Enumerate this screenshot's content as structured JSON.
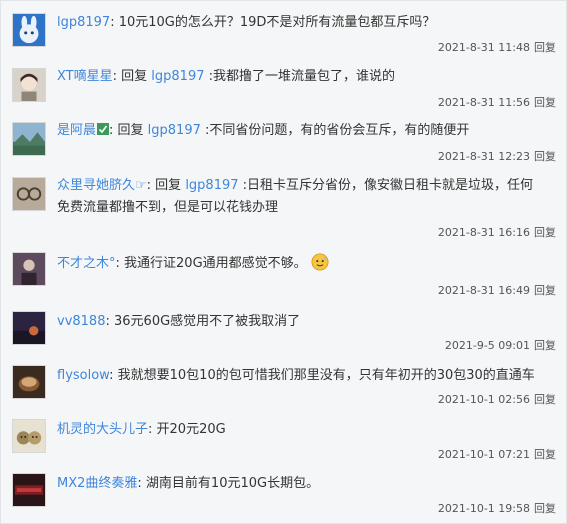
{
  "comments": [
    {
      "user": "lgp8197",
      "separator": ": ",
      "text": "10元10G的怎么开？19D不是对所有流量包都互斥吗？",
      "time": "2021-8-31 11:48",
      "reply_label": "回复",
      "avatar_color": "#3a83d6"
    },
    {
      "user": "XT嘀星星",
      "separator": ": 回复 ",
      "reply_to": "lgp8197",
      "text": " :我都撸了一堆流量包了，谁说的",
      "time": "2021-8-31 11:56",
      "reply_label": "回复",
      "avatar_color": "#c9c2b9"
    },
    {
      "user": "是阿晨",
      "badge_icon": "check-badge-icon",
      "separator": ": 回复 ",
      "reply_to": "lgp8197",
      "text": " :不同省份问题，有的省份会互斥，有的随便开",
      "time": "2021-8-31 12:23",
      "reply_label": "回复",
      "avatar_color": "#5b88a8"
    },
    {
      "user": "众里寻她脐久☞",
      "separator": ": 回复 ",
      "reply_to": "lgp8197",
      "text": " :日租卡互斥分省份，像安徽日租卡就是垃圾，任何",
      "text_line2": "免费流量都撸不到，但是可以花钱办理",
      "time": "2021-8-31 16:16",
      "reply_label": "回复",
      "avatar_color": "#8a7c6c"
    },
    {
      "user": "不才之木°",
      "separator": ": ",
      "text": "我通行证20G通用都感觉不够。",
      "emoji": "sweat-smile-emoji-icon",
      "time": "2021-8-31 16:49",
      "reply_label": "回复",
      "avatar_color": "#6d5a6b"
    },
    {
      "user": "vv8188",
      "separator": ": ",
      "text": "36元60G感觉用不了被我取消了",
      "time": "2021-9-5 09:01",
      "reply_label": "回复",
      "avatar_color": "#3b2f4a"
    },
    {
      "user": "flysolow",
      "separator": ": ",
      "text": "我就想要10包10的包可惜我们那里没有，只有年初开的30包30的直通车",
      "time": "2021-10-1 02:56",
      "reply_label": "回复",
      "avatar_color": "#6a4a32"
    },
    {
      "user": "机灵的大头儿子",
      "separator": ": ",
      "text": "开20元20G",
      "time": "2021-10-1 07:21",
      "reply_label": "回复",
      "avatar_color": "#b5a27a"
    },
    {
      "user": "MX2曲终奏雅",
      "separator": ": ",
      "text": "湖南目前有10元10G长期包。",
      "time": "2021-10-1 19:58",
      "reply_label": "回复",
      "avatar_color": "#7a1f22"
    }
  ]
}
